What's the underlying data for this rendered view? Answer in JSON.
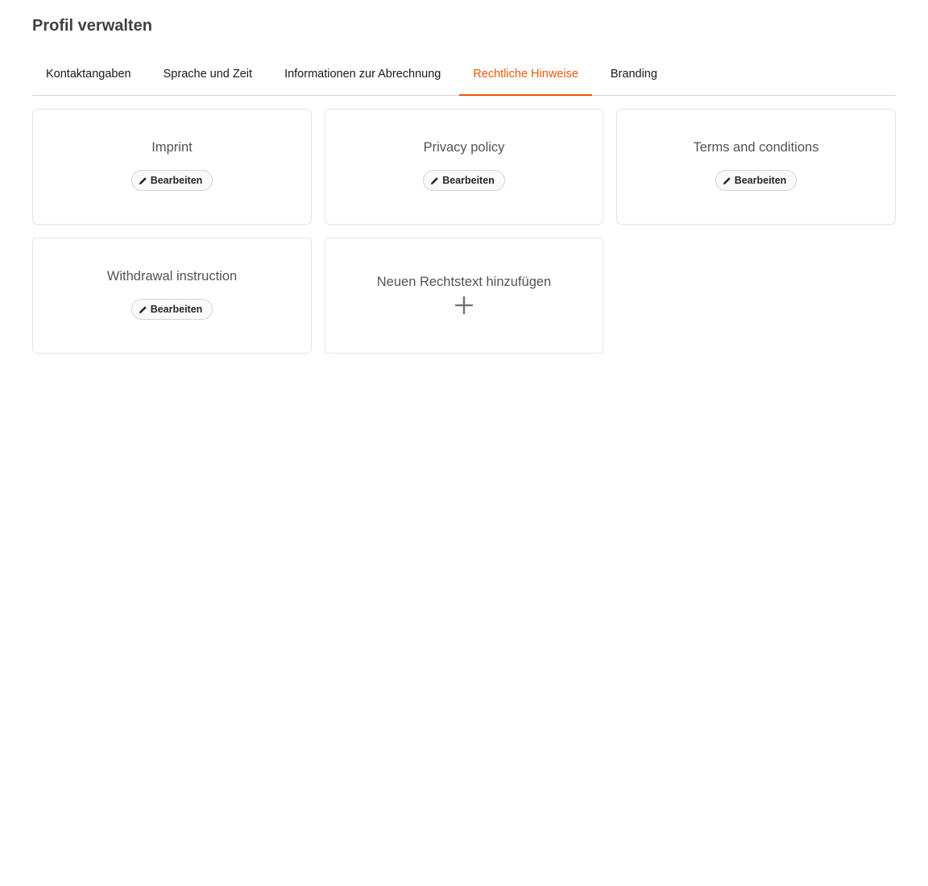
{
  "page": {
    "title": "Profil verwalten"
  },
  "tabs": [
    {
      "label": "Kontaktangaben",
      "active": false
    },
    {
      "label": "Sprache und Zeit",
      "active": false
    },
    {
      "label": "Informationen zur Abrechnung",
      "active": false
    },
    {
      "label": "Rechtliche Hinweise",
      "active": true
    },
    {
      "label": "Branding",
      "active": false
    }
  ],
  "cards": [
    {
      "title": "Imprint",
      "button_label": "Bearbeiten",
      "button_icon": "pencil-icon"
    },
    {
      "title": "Privacy policy",
      "button_label": "Bearbeiten",
      "button_icon": "pencil-icon"
    },
    {
      "title": "Terms and conditions",
      "button_label": "Bearbeiten",
      "button_icon": "pencil-icon"
    },
    {
      "title": "Withdrawal instruction",
      "button_label": "Bearbeiten",
      "button_icon": "pencil-icon"
    }
  ],
  "add_card": {
    "title": "Neuen Rechtstext hinzufügen",
    "icon": "plus-icon"
  },
  "colors": {
    "accent": "#ea580c",
    "text": "#3f3f46",
    "border": "#e4e4e7"
  }
}
